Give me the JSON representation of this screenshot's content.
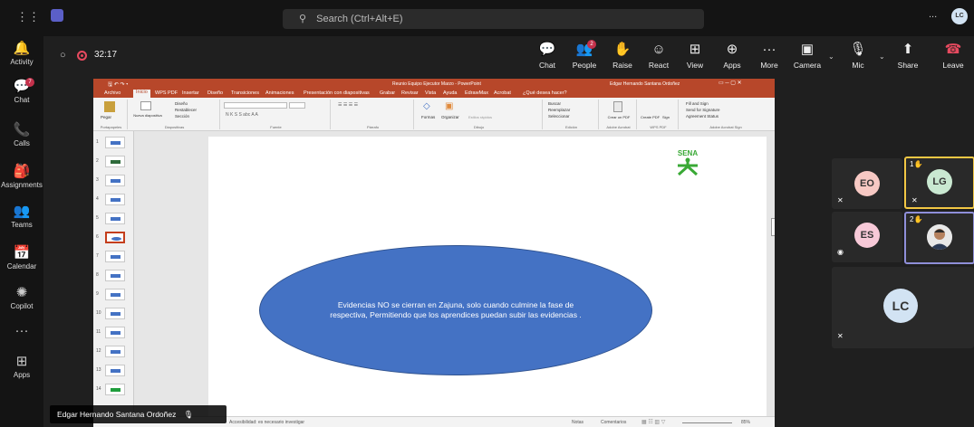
{
  "titlebar": {
    "search_placeholder": "Search (Ctrl+Alt+E)",
    "more": "...",
    "avatar": "LC"
  },
  "rail": [
    {
      "label": "Activity",
      "icon": "bell-icon",
      "glyph": "🔔"
    },
    {
      "label": "Chat",
      "icon": "chat-icon",
      "glyph": "💬",
      "badge": "7"
    },
    {
      "label": "Calls",
      "icon": "phone-icon",
      "glyph": "📞"
    },
    {
      "label": "Assignments",
      "icon": "backpack-icon",
      "glyph": "🎒"
    },
    {
      "label": "Teams",
      "icon": "teams-icon",
      "glyph": "👥"
    },
    {
      "label": "Calendar",
      "icon": "calendar-icon",
      "glyph": "📅"
    },
    {
      "label": "Copilot",
      "icon": "copilot-icon",
      "glyph": "✺"
    },
    {
      "label": "",
      "icon": "more-icon",
      "glyph": "···"
    },
    {
      "label": "Apps",
      "icon": "apps-icon",
      "glyph": "⊞"
    }
  ],
  "call": {
    "timer": "32:17",
    "controls": [
      {
        "label": "Chat",
        "icon": "chat-icon",
        "glyph": "💬"
      },
      {
        "label": "People",
        "icon": "people-icon",
        "glyph": "👥",
        "badge": "2"
      },
      {
        "label": "Raise",
        "icon": "raise-hand-icon",
        "glyph": "✋"
      },
      {
        "label": "React",
        "icon": "react-icon",
        "glyph": "☺"
      },
      {
        "label": "View",
        "icon": "view-icon",
        "glyph": "⊞"
      },
      {
        "label": "Apps",
        "icon": "apps-icon",
        "glyph": "⊕"
      },
      {
        "label": "More",
        "icon": "more-icon",
        "glyph": "···"
      }
    ],
    "camera": "Camera",
    "mic": "Mic",
    "share": "Share",
    "leave": "Leave"
  },
  "powerpoint": {
    "title": "Reunio Equipo Ejecutor Marzo - PowerPoint",
    "user": "Edgar Hernando Santana Ordoñez",
    "tabs": [
      "Archivo",
      "Inicio",
      "WPS PDF",
      "Insertar",
      "Diseño",
      "Transiciones",
      "Animaciones",
      "Presentación con diapositivas",
      "Grabar",
      "Revisar",
      "Vista",
      "Ayuda",
      "EdrawMax",
      "Acrobat",
      "¿Qué desea hacer?"
    ],
    "groups": [
      "Portapapeles",
      "Diapositivas",
      "Fuente",
      "Párrafo",
      "Dibujo",
      "Edición",
      "Adobe Acrobat",
      "WPS PDF",
      "Adobe Acrobat Sign"
    ],
    "ribbon": {
      "pegar": "Pegar",
      "nueva": "Nueva diapositiva",
      "diseno": "Diseño",
      "restablecer": "Restablecer",
      "seccion": "Sección",
      "formas": "Formas",
      "organizar": "Organizar",
      "estilos": "Estilos rápidos",
      "buscar": "Buscar",
      "reemplazar": "Reemplazar",
      "seleccionar": "Seleccionar",
      "crear_pdf": "Crear un PDF",
      "create_sign": "Create PDF",
      "sign": "Sign",
      "fill": "Fill and Sign",
      "send": "Send for Signature",
      "agreement": "Agreement Status"
    },
    "thumbs": [
      "1",
      "2",
      "3",
      "4",
      "5",
      "6",
      "7",
      "8",
      "9",
      "10",
      "11",
      "12",
      "13",
      "14"
    ],
    "slide_logo": "SENA",
    "slide_text": "Evidencias NO se cierran en Zajuna, solo cuando culmine la fase de respectiva, Permitiendo que los aprendices puedan subir las evidencias .",
    "status_text": "Accesibilidad: es necesario investigar",
    "notas": "Notas",
    "comentarios": "Comentarios",
    "zoom": "85%"
  },
  "presenter_name": "Edgar Hernando Santana Ordoñez",
  "participants": [
    {
      "initials": "EO",
      "color": "#f7c9c4"
    },
    {
      "initials": "LG",
      "color": "#c9e8d1",
      "hand": "1"
    },
    {
      "initials": "ES",
      "color": "#f7c9d8"
    },
    {
      "initials": "",
      "hand": "2"
    },
    {
      "initials": "LC",
      "color": "#d2e3f3"
    }
  ]
}
